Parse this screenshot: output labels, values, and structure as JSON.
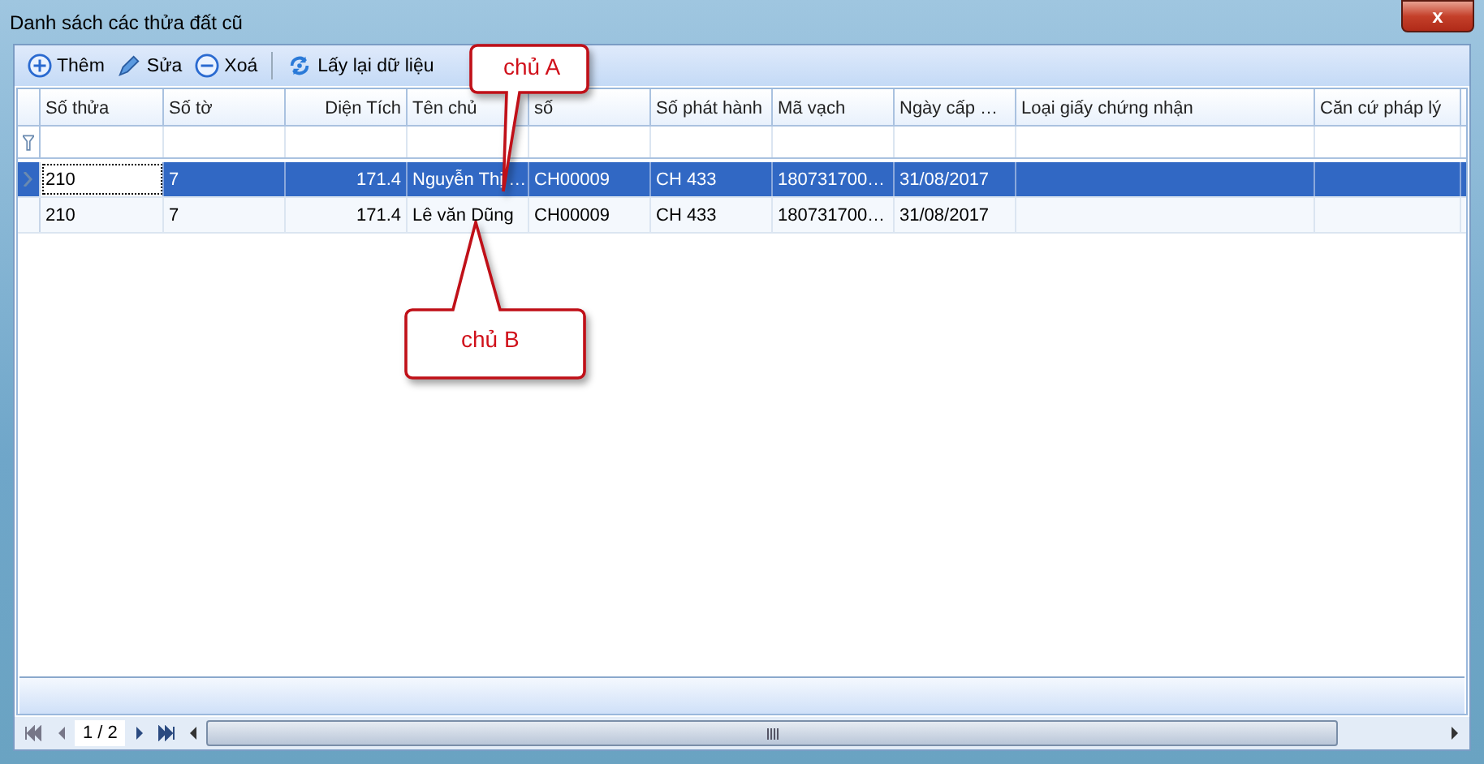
{
  "window": {
    "title": "Danh sách các thửa đất cũ",
    "close": "x"
  },
  "toolbar": [
    {
      "kind": "add",
      "label": "Thêm"
    },
    {
      "kind": "edit",
      "label": "Sửa"
    },
    {
      "kind": "delete",
      "label": "Xoá"
    },
    {
      "kind": "refresh",
      "label": "Lấy lại dữ liệu"
    }
  ],
  "table": {
    "columns": [
      {
        "label": "Số thửa",
        "numeric": false
      },
      {
        "label": "Số tờ",
        "numeric": false
      },
      {
        "label": "Diện Tích",
        "numeric": true
      },
      {
        "label": "Tên chủ",
        "numeric": false
      },
      {
        "label": "số",
        "numeric": false
      },
      {
        "label": "Số phát hành",
        "numeric": false
      },
      {
        "label": "Mã vạch",
        "numeric": false
      },
      {
        "label": "Ngày cấp …",
        "numeric": false
      },
      {
        "label": "Loại giấy chứng nhận",
        "numeric": false
      },
      {
        "label": "Căn cứ pháp lý",
        "numeric": false
      }
    ],
    "rows": [
      {
        "selected": true,
        "cells": [
          "210",
          "7",
          "171.4",
          "Nguyễn Thị …",
          "CH00009",
          "CH 433",
          "180731700…",
          "31/08/2017",
          "",
          ""
        ]
      },
      {
        "selected": false,
        "cells": [
          "210",
          "7",
          "171.4",
          "Lê văn Dũng",
          "CH00009",
          "CH 433",
          "180731700…",
          "31/08/2017",
          "",
          ""
        ]
      }
    ]
  },
  "callouts": [
    {
      "label": "chủ A",
      "kind": "above"
    },
    {
      "label": "chủ B",
      "kind": "below"
    }
  ],
  "pager": {
    "page": "1 / 2"
  }
}
